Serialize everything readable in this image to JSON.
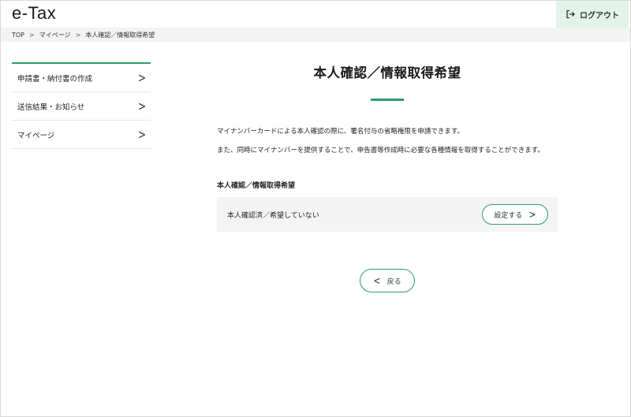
{
  "header": {
    "logo": "e-Tax",
    "logout_label": "ログアウト"
  },
  "breadcrumb": {
    "items": [
      "TOP",
      "マイページ",
      "本人確認／情報取得希望"
    ],
    "separator": ">"
  },
  "sidebar": {
    "items": [
      {
        "label": "申請書・納付書の作成"
      },
      {
        "label": "送信結果・お知らせ"
      },
      {
        "label": "マイページ"
      }
    ]
  },
  "main": {
    "title": "本人確認／情報取得希望",
    "description": [
      "マイナンバーカードによる本人確認の際に、署名付与の省略権限を申請できます。",
      "また、同時にマイナンバーを提供することで、申告書等作成時に必要な各種情報を取得することができます。"
    ],
    "section_label": "本人確認／情報取得希望",
    "status_text": "本人確認済／希望していない",
    "set_button_label": "設定する",
    "back_button_label": "戻る"
  },
  "icons": {
    "logout": "logout-icon",
    "chevron": "chevron-right-icon",
    "back": "chevron-left-icon"
  },
  "colors": {
    "accent": "#2e9d69",
    "logout_bg": "#e3f3ea",
    "row_bg": "#f4f4f4"
  }
}
